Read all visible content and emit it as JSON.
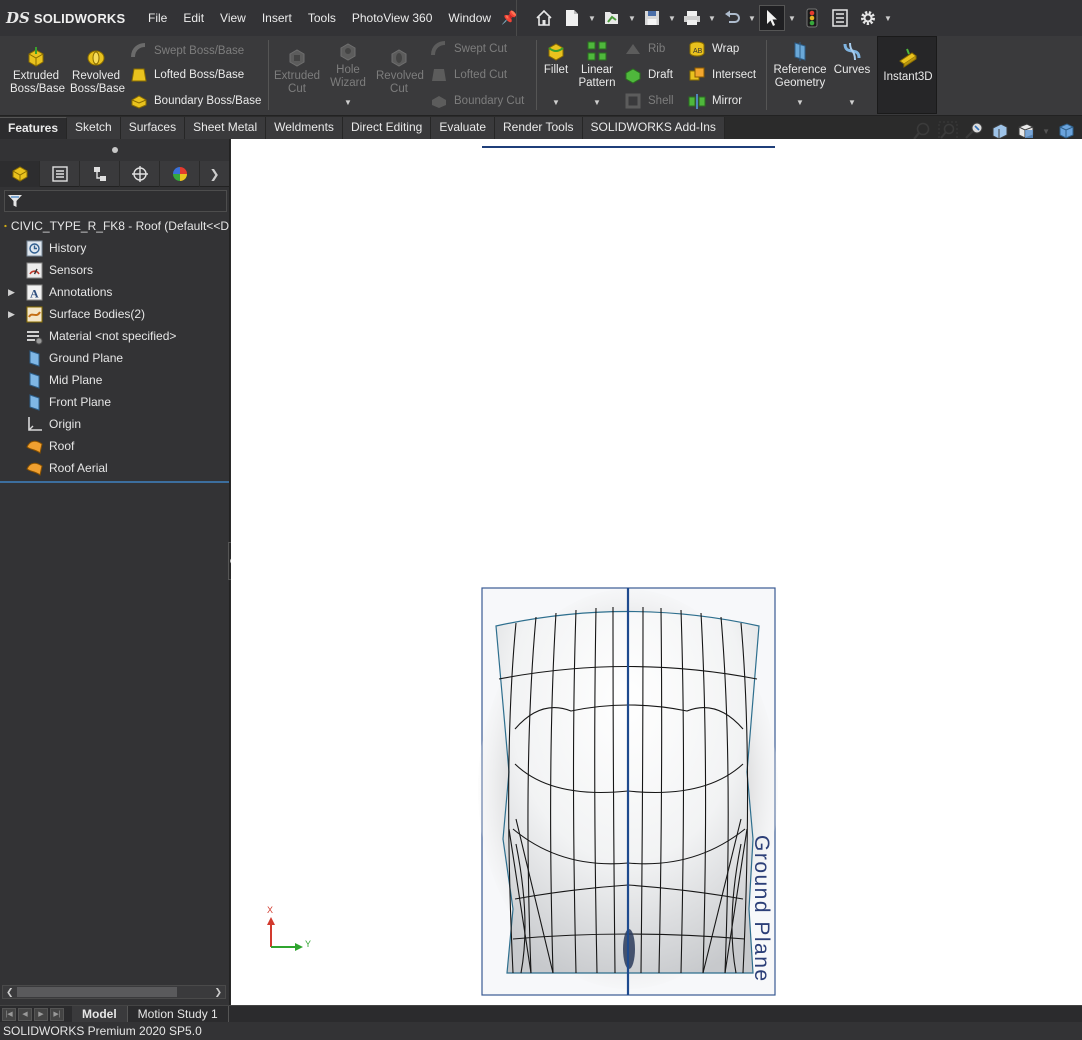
{
  "app": {
    "logo_prefix": "DS",
    "brand": "SOLIDWORKS",
    "accent": "#1f5fa8"
  },
  "menu": [
    "File",
    "Edit",
    "View",
    "Insert",
    "Tools",
    "PhotoView 360",
    "Window"
  ],
  "ribbon": {
    "extruded_boss": "Extruded Boss/Base",
    "revolved_boss": "Revolved Boss/Base",
    "swept_boss": "Swept Boss/Base",
    "lofted_boss": "Lofted Boss/Base",
    "boundary_boss": "Boundary Boss/Base",
    "extruded_cut": "Extruded Cut",
    "hole_wizard": "Hole Wizard",
    "revolved_cut": "Revolved Cut",
    "swept_cut": "Swept Cut",
    "lofted_cut": "Lofted Cut",
    "boundary_cut": "Boundary Cut",
    "fillet": "Fillet",
    "linear_pattern": "Linear Pattern",
    "rib": "Rib",
    "draft": "Draft",
    "shell": "Shell",
    "wrap": "Wrap",
    "intersect": "Intersect",
    "mirror": "Mirror",
    "reference_geometry": "Reference Geometry",
    "curves": "Curves",
    "instant3d": "Instant3D"
  },
  "tabs": [
    "Features",
    "Sketch",
    "Surfaces",
    "Sheet Metal",
    "Weldments",
    "Direct Editing",
    "Evaluate",
    "Render Tools",
    "SOLIDWORKS Add-Ins"
  ],
  "tree": {
    "root": "CIVIC_TYPE_R_FK8 - Roof  (Default<<D",
    "items": [
      {
        "label": "History",
        "icon": "history-icon"
      },
      {
        "label": "Sensors",
        "icon": "sensors-icon"
      },
      {
        "label": "Annotations",
        "icon": "annotations-icon"
      },
      {
        "label": "Surface Bodies(2)",
        "icon": "surface-bodies-icon"
      },
      {
        "label": "Material <not specified>",
        "icon": "material-icon"
      },
      {
        "label": "Ground Plane",
        "icon": "plane-icon"
      },
      {
        "label": "Mid Plane",
        "icon": "plane-icon"
      },
      {
        "label": "Front Plane",
        "icon": "plane-icon"
      },
      {
        "label": "Origin",
        "icon": "origin-icon"
      },
      {
        "label": "Roof",
        "icon": "surface-feature-icon"
      },
      {
        "label": "Roof Aerial",
        "icon": "surface-feature-icon"
      }
    ]
  },
  "viewport": {
    "plane_label": "Ground Plane",
    "triad_x": "X",
    "triad_y": "Y"
  },
  "bottom_tabs": [
    "Model",
    "Motion Study 1"
  ],
  "status": "SOLIDWORKS Premium 2020 SP5.0"
}
